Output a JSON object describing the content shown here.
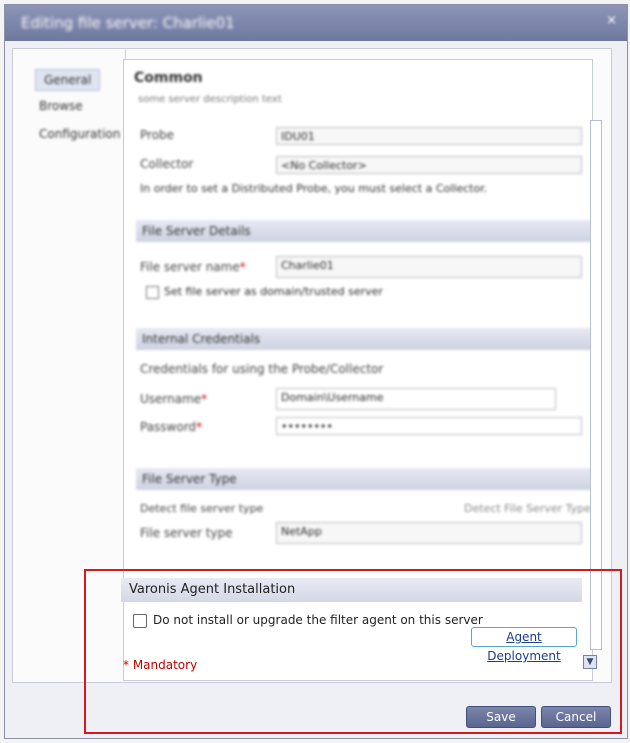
{
  "dialog": {
    "title": "Editing file server: Charlie01",
    "close_glyph": "×"
  },
  "sidebar": {
    "items": [
      {
        "label": "General",
        "active": true
      },
      {
        "label": "Browse",
        "active": false
      },
      {
        "label": "Configuration",
        "active": false
      }
    ]
  },
  "general": {
    "heading": "Common",
    "subtitle": "some server description text",
    "probe_label": "Probe",
    "probe_value": "IDU01",
    "collector_label": "Collector",
    "collector_value": "<No Collector>",
    "collector_hint": "In order to set a Distributed Probe, you must select a Collector."
  },
  "file_server_details": {
    "header": "File Server Details",
    "name_label": "File server name",
    "name_value": "Charlie01",
    "file_server_check": "Set file server as domain/trusted server"
  },
  "credentials": {
    "header": "Internal Credentials",
    "same_label": "Credentials for using the Probe/Collector",
    "user_label": "Username",
    "user_value": "Domain\\Username",
    "password_label": "Password",
    "password_value": "••••••••"
  },
  "file_server_type": {
    "header": "File Server Type",
    "detect_label": "Detect file server type",
    "detect_link": "Detect File Server Type",
    "type_label": "File server type",
    "type_value": "NetApp"
  },
  "agent": {
    "header": "Varonis Agent Installation",
    "checkbox_label": "Do not install or upgrade the filter agent on this server",
    "deploy_button": "Agent Deployment"
  },
  "mandatory_note": "* Mandatory",
  "buttons": {
    "save": "Save",
    "cancel": "Cancel"
  },
  "colors": {
    "title_bar": "#7a84a8",
    "accent_link": "#1b3d8c",
    "highlight": "#d7191e",
    "mandatory": "#c00000"
  }
}
